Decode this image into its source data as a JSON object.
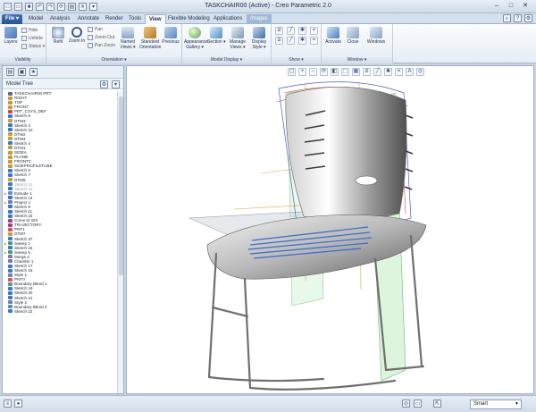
{
  "window": {
    "title": "TASKCHAIR00 (Active) - Creo Parametric 2.0",
    "controls": [
      "–",
      "□",
      "✕"
    ]
  },
  "tabs": [
    {
      "label": "File ▾",
      "name": "file"
    },
    {
      "label": "Model",
      "name": "model"
    },
    {
      "label": "Analysis",
      "name": "analysis"
    },
    {
      "label": "Annotate",
      "name": "annotate"
    },
    {
      "label": "Render",
      "name": "render"
    },
    {
      "label": "Tools",
      "name": "tools"
    },
    {
      "label": "View",
      "name": "view"
    },
    {
      "label": "Flexible Modeling",
      "name": "flexible-modeling"
    },
    {
      "label": "Applications",
      "name": "applications"
    },
    {
      "label": "Images",
      "name": "images"
    }
  ],
  "ribbon": {
    "visibility": {
      "label": "Visibility",
      "layers": "Layers",
      "hide": "Hide",
      "unhide": "Unhide",
      "status": "Status ▾"
    },
    "orientation": {
      "label": "Orientation ▾",
      "refit": "Refit",
      "zoom_in": "Zoom In",
      "pan": "Pan",
      "zoom_out": "Zoom Out",
      "pan_zoom": "Pan Zoom",
      "named_views": "Named Views ▾",
      "standard_orientation": "Standard Orientation",
      "previous": "Previous"
    },
    "model_display": {
      "label": "Model Display ▾",
      "appearance_gallery": "Appearance Gallery ▾",
      "section": "Section ▾",
      "manage_views": "Manage Views ▾",
      "display_style": "Display Style ▾"
    },
    "show": {
      "label": "Show ▾"
    },
    "window": {
      "label": "Window ▾",
      "activate": "Activate",
      "close": "Close",
      "windows": "Windows"
    }
  },
  "navigator": {
    "tree_title": "Model Tree",
    "items": [
      {
        "label": "TASKCHAIR00.PRT",
        "exp": "",
        "icon": "part",
        "dim": false
      },
      {
        "label": "RIGHT",
        "exp": "",
        "icon": "datum-plane",
        "dim": false
      },
      {
        "label": "TOP",
        "exp": "",
        "icon": "datum-plane",
        "dim": false
      },
      {
        "label": "FRONT",
        "exp": "",
        "icon": "datum-plane",
        "dim": false
      },
      {
        "label": "PRT_CSYS_DEF",
        "exp": "",
        "icon": "csys",
        "dim": false
      },
      {
        "label": "Sketch 9",
        "exp": "",
        "icon": "sketch",
        "dim": false
      },
      {
        "label": "DTM3",
        "exp": "",
        "icon": "datum-plane",
        "dim": false
      },
      {
        "label": "Sketch 3",
        "exp": "",
        "icon": "sketch",
        "dim": false
      },
      {
        "label": "Sketch 10",
        "exp": "",
        "icon": "sketch",
        "dim": false
      },
      {
        "label": "DTM2",
        "exp": "",
        "icon": "datum-plane",
        "dim": false
      },
      {
        "label": "DTM4",
        "exp": "",
        "icon": "datum-plane",
        "dim": false
      },
      {
        "label": "Sketch 4",
        "exp": "",
        "icon": "sketch",
        "dim": false
      },
      {
        "label": "DTM1",
        "exp": "",
        "icon": "datum-plane",
        "dim": false
      },
      {
        "label": "SIDEA",
        "exp": "",
        "icon": "datum-plane",
        "dim": false
      },
      {
        "label": "PLANB",
        "exp": "",
        "icon": "datum-plane",
        "dim": false
      },
      {
        "label": "FRONTC",
        "exp": "",
        "icon": "datum-plane",
        "dim": false
      },
      {
        "label": "SIDEPROFILETUBE",
        "exp": "",
        "icon": "datum-plane",
        "dim": false
      },
      {
        "label": "Sketch 6",
        "exp": "",
        "icon": "sketch",
        "dim": false
      },
      {
        "label": "Sketch 7",
        "exp": "",
        "icon": "sketch",
        "dim": false
      },
      {
        "label": "DTM5",
        "exp": "",
        "icon": "datum-plane",
        "dim": false
      },
      {
        "label": "Sketch 12",
        "exp": "",
        "icon": "sketch",
        "dim": true
      },
      {
        "label": "Sketch 13",
        "exp": "",
        "icon": "sketch",
        "dim": true
      },
      {
        "label": "Extrude 1",
        "exp": "▸",
        "icon": "extrude",
        "dim": false
      },
      {
        "label": "Sketch 14",
        "exp": "",
        "icon": "sketch",
        "dim": false
      },
      {
        "label": "Project 1",
        "exp": "▸",
        "icon": "feature",
        "dim": false
      },
      {
        "label": "Sketch 8",
        "exp": "",
        "icon": "sketch",
        "dim": false
      },
      {
        "label": "Sketch 11",
        "exp": "",
        "icon": "sketch",
        "dim": false
      },
      {
        "label": "Sketch 15",
        "exp": "",
        "icon": "sketch",
        "dim": false
      },
      {
        "label": "Curve id 333",
        "exp": "",
        "icon": "curve",
        "dim": false
      },
      {
        "label": "TRAJECTORY",
        "exp": "",
        "icon": "curve",
        "dim": false
      },
      {
        "label": "PNT1",
        "exp": "",
        "icon": "point",
        "dim": false
      },
      {
        "label": "DTM7",
        "exp": "",
        "icon": "datum-plane",
        "dim": false
      },
      {
        "label": "Sketch 37",
        "exp": "",
        "icon": "sketch",
        "dim": false
      },
      {
        "label": "Sweep 1",
        "exp": "▸",
        "icon": "sweep",
        "dim": false
      },
      {
        "label": "Sketch 16",
        "exp": "",
        "icon": "sketch",
        "dim": false
      },
      {
        "label": "Sweep 5",
        "exp": "▸",
        "icon": "sweep",
        "dim": false
      },
      {
        "label": "Merge 4",
        "exp": "",
        "icon": "feature",
        "dim": false
      },
      {
        "label": "Chamfer 1",
        "exp": "",
        "icon": "feature",
        "dim": false
      },
      {
        "label": "Sketch 17",
        "exp": "",
        "icon": "sketch",
        "dim": false
      },
      {
        "label": "Sketch 18",
        "exp": "",
        "icon": "sketch",
        "dim": false
      },
      {
        "label": "Style 1",
        "exp": "",
        "icon": "feature",
        "dim": false
      },
      {
        "label": "PNT0",
        "exp": "",
        "icon": "point",
        "dim": false
      },
      {
        "label": "Boundary Blend 1",
        "exp": "",
        "icon": "blend",
        "dim": false
      },
      {
        "label": "Sketch 19",
        "exp": "",
        "icon": "sketch",
        "dim": false
      },
      {
        "label": "Sketch 20",
        "exp": "",
        "icon": "sketch",
        "dim": false
      },
      {
        "label": "Sketch 21",
        "exp": "",
        "icon": "sketch",
        "dim": false
      },
      {
        "label": "Style 2",
        "exp": "",
        "icon": "feature",
        "dim": false
      },
      {
        "label": "Boundary Blend 2",
        "exp": "",
        "icon": "blend",
        "dim": false
      },
      {
        "label": "Sketch 22",
        "exp": "",
        "icon": "sketch",
        "dim": false
      }
    ]
  },
  "status": {
    "filter": "Smart"
  },
  "colors": {
    "sketch": "#3a78c8",
    "datum-plane": "#c89a3a",
    "csys": "#c84a4a",
    "part": "#5a6a8a",
    "extrude": "#6a8fc0",
    "feature": "#7a7aa8",
    "curve": "#a83a8a",
    "point": "#c85a5a",
    "sweep": "#4a9a6a",
    "blend": "#5a8fb0"
  }
}
